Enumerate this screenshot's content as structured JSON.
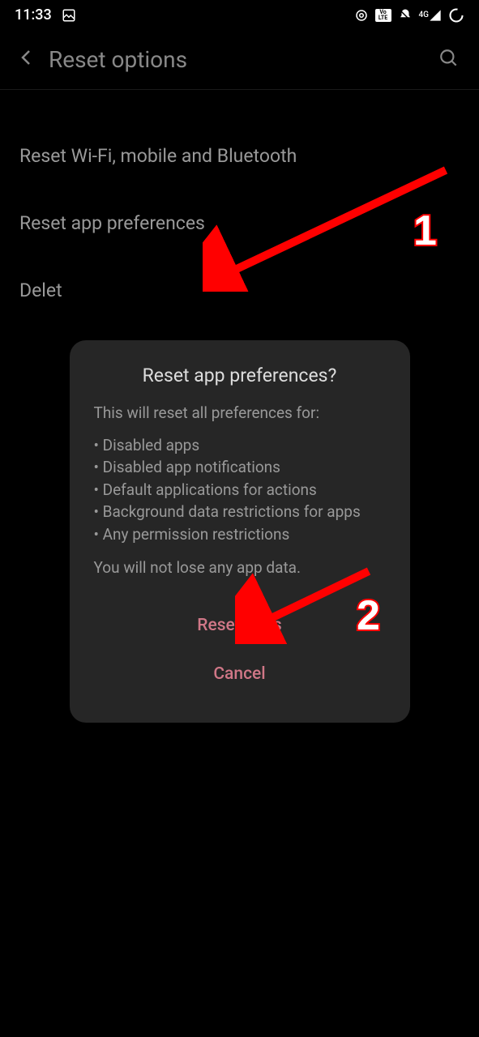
{
  "status_bar": {
    "time": "11:33",
    "network_label": "4G"
  },
  "header": {
    "title": "Reset options"
  },
  "options": {
    "item1": "Reset Wi-Fi, mobile and Bluetooth",
    "item2": "Reset app preferences",
    "item3": "Delet"
  },
  "dialog": {
    "title": "Reset app preferences?",
    "intro": "This will reset all preferences for:",
    "bullet1": "• Disabled apps",
    "bullet2": "• Disabled app notifications",
    "bullet3": "• Default applications for actions",
    "bullet4": "• Background data restrictions for apps",
    "bullet5": "• Any permission restrictions",
    "footer": "You will not lose any app data.",
    "confirm": "Reset apps",
    "cancel": "Cancel"
  },
  "annotations": {
    "num1": "1",
    "num2": "2"
  }
}
